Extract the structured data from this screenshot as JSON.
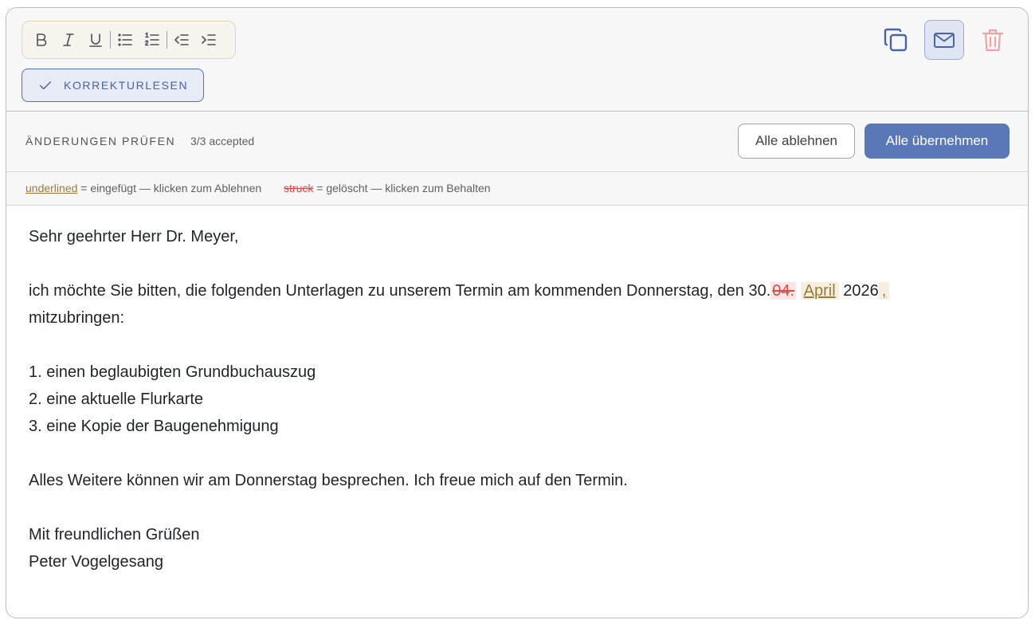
{
  "toolbar": {
    "proofread_label": "KORREKTURLESEN"
  },
  "review": {
    "title": "ÄNDERUNGEN PRÜFEN",
    "count": "3/3 accepted",
    "reject_all": "Alle ablehnen",
    "accept_all": "Alle übernehmen"
  },
  "legend": {
    "inserted_sample": "underlined",
    "inserted_text": "= eingefügt — klicken zum Ablehnen",
    "deleted_sample": "struck",
    "deleted_text": "= gelöscht — klicken zum Behalten"
  },
  "letter": {
    "salutation": "Sehr geehrter Herr Dr. Meyer,",
    "line1_before": "ich möchte Sie bitten, die folgenden Unterlagen zu unserem Termin am kommenden Donnerstag, den 30.",
    "line1_deleted": "04.",
    "line1_inserted": "April",
    "line1_after": "2026",
    "line1_inserted2": ",",
    "line2": "mitzubringen:",
    "item1": "1. einen beglaubigten Grundbuchauszug",
    "item2": "2. eine aktuelle Flurkarte",
    "item3": "3. eine Kopie der Baugenehmigung",
    "closing_text": "Alles Weitere können wir am Donnerstag besprechen. Ich freue mich auf den Termin.",
    "regards": "Mit freundlichen Grüßen",
    "signature": "Peter Vogelgesang"
  },
  "colors": {
    "accent": "#5a78b8",
    "inserted": "#9a7a3e",
    "deleted": "#d84a4a"
  }
}
